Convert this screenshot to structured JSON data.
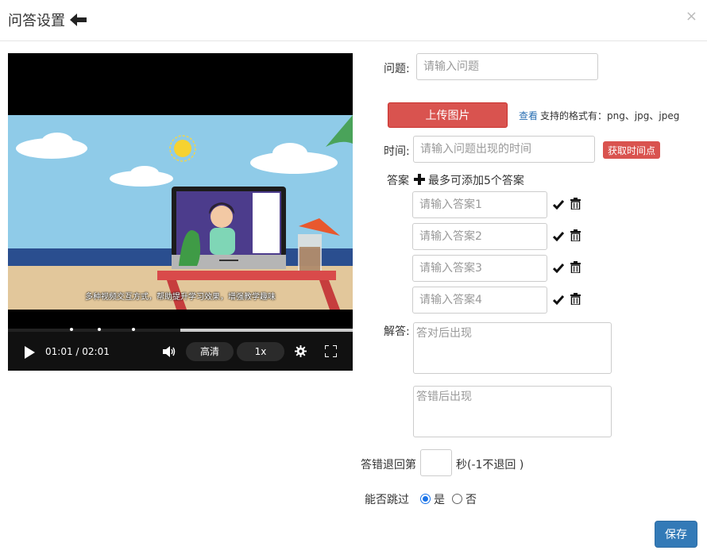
{
  "modal": {
    "title": "问答设置",
    "close": "×"
  },
  "player": {
    "subtitle": "多种视频交互方式，帮助提升学习效果，增强教学趣味",
    "time": "01:01 / 02:01",
    "quality": "高清",
    "speed": "1x",
    "progress_fraction": 0.5,
    "buffer_fraction": 1.0,
    "marker_fractions": [
      0.18,
      0.26,
      0.36
    ]
  },
  "form": {
    "question_label": "问题:",
    "question_placeholder": "请输入问题",
    "upload_label": "上传图片",
    "view_link": "查看",
    "formats_text": "支持的格式有：png、jpg、jpeg",
    "time_label": "时间:",
    "time_placeholder": "请输入问题出现的时间",
    "get_time_label": "获取时间点",
    "answers_label": "答案",
    "answers_hint": "最多可添加5个答案",
    "answers": [
      {
        "placeholder": "请输入答案1"
      },
      {
        "placeholder": "请输入答案2"
      },
      {
        "placeholder": "请输入答案3"
      },
      {
        "placeholder": "请输入答案4"
      }
    ],
    "explain_label": "解答:",
    "correct_placeholder": "答对后出现",
    "wrong_placeholder": "答错后出现",
    "rollback_prefix": "答错退回第",
    "rollback_suffix": "秒(-1不退回 )",
    "skip_label": "能否跳过",
    "skip_yes": "是",
    "skip_no": "否",
    "save_label": "保存"
  },
  "colors": {
    "danger": "#d9534f",
    "primary": "#337ab7",
    "link": "#2a6fb3",
    "radio": "#1a73e8"
  }
}
